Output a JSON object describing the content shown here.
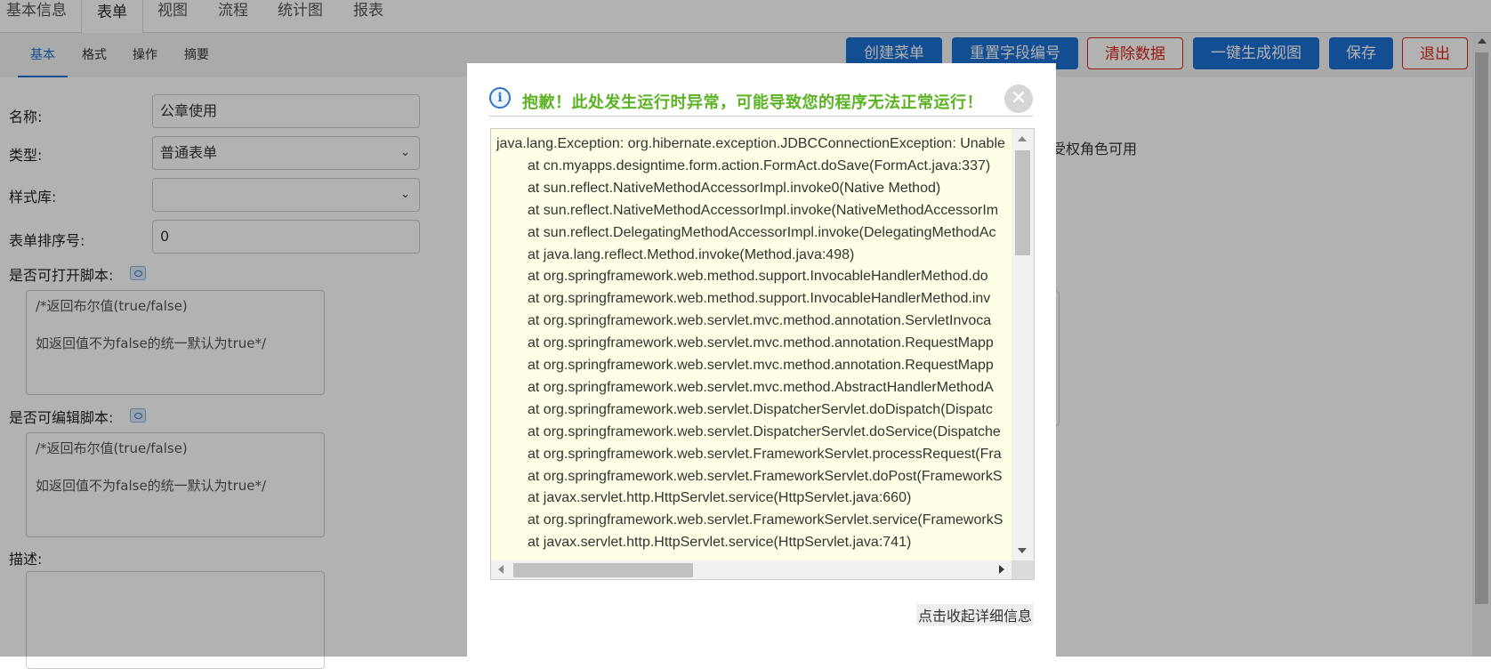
{
  "top_tabs": [
    "基本信息",
    "表单",
    "视图",
    "流程",
    "统计图",
    "报表"
  ],
  "sub_tabs": [
    "基本",
    "格式",
    "操作",
    "摘要"
  ],
  "toolbar": {
    "create_menu": "创建菜单",
    "reset_field_no": "重置字段编号",
    "clear_data": "清除数据",
    "generate_view": "一键生成视图",
    "save": "保存",
    "exit": "退出"
  },
  "form": {
    "name_label": "名称:",
    "name_value": "公章使用",
    "type_label": "类型:",
    "type_value": "普通表单",
    "style_label": "样式库:",
    "style_value": "",
    "order_label": "表单排序号:",
    "order_value": "0",
    "open_script_label": "是否可打开脚本:",
    "open_script_line1": "/*返回布尔值(true/false)",
    "open_script_line2": "如返回值不为false的统一默认为true*/",
    "edit_script_label": "是否可编辑脚本:",
    "edit_script_line1": "/*返回布尔值(true/false)",
    "edit_script_line2": "如返回值不为false的统一默认为true*/",
    "desc_label": "描述:",
    "right_partial_text": "受权角色可用"
  },
  "dialog": {
    "title": "抱歉！此处发生运行时异常，可能导致您的程序无法正常运行！",
    "close_glyph": "✕",
    "info_glyph": "i",
    "error_lines": [
      "java.lang.Exception: org.hibernate.exception.JDBCConnectionException: Unable",
      "at cn.myapps.designtime.form.action.FormAct.doSave(FormAct.java:337)",
      "at sun.reflect.NativeMethodAccessorImpl.invoke0(Native Method)",
      "at sun.reflect.NativeMethodAccessorImpl.invoke(NativeMethodAccessorIm",
      "at sun.reflect.DelegatingMethodAccessorImpl.invoke(DelegatingMethodAc",
      "at java.lang.reflect.Method.invoke(Method.java:498)",
      "at org.springframework.web.method.support.InvocableHandlerMethod.do",
      "at org.springframework.web.method.support.InvocableHandlerMethod.inv",
      "at org.springframework.web.servlet.mvc.method.annotation.ServletInvoca",
      "at org.springframework.web.servlet.mvc.method.annotation.RequestMapp",
      "at org.springframework.web.servlet.mvc.method.annotation.RequestMapp",
      "at org.springframework.web.servlet.mvc.method.AbstractHandlerMethodA",
      "at org.springframework.web.servlet.DispatcherServlet.doDispatch(Dispatc",
      "at org.springframework.web.servlet.DispatcherServlet.doService(Dispatche",
      "at org.springframework.web.servlet.FrameworkServlet.processRequest(Fra",
      "at org.springframework.web.servlet.FrameworkServlet.doPost(FrameworkS",
      "at javax.servlet.http.HttpServlet.service(HttpServlet.java:660)",
      "at org.springframework.web.servlet.FrameworkServlet.service(FrameworkS",
      "at javax.servlet.http.HttpServlet.service(HttpServlet.java:741)"
    ],
    "collapse_link": "点击收起详细信息"
  },
  "colors": {
    "primary": "#1c6fd1",
    "danger": "#d9261c",
    "title_green": "#5bb324",
    "error_bg": "#ffffe6"
  }
}
